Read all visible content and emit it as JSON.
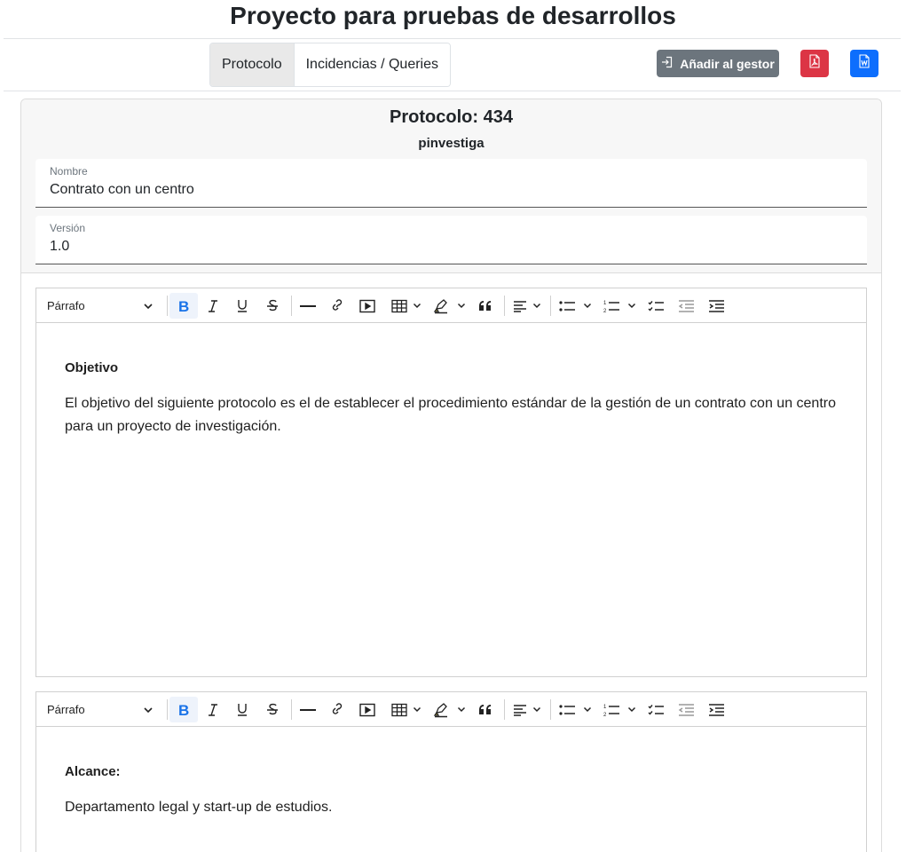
{
  "page": {
    "title": "Proyecto para pruebas de desarrollos"
  },
  "tabs": [
    {
      "label": "Protocolo",
      "active": true
    },
    {
      "label": "Incidencias / Queries",
      "active": false
    }
  ],
  "actions": {
    "add_manager_label": "Añadir al gestor",
    "pdf_icon": "file-pdf-icon",
    "word_icon": "file-word-icon"
  },
  "protocol": {
    "title": "Protocolo: 434",
    "user": "pinvestiga"
  },
  "fields": {
    "name": {
      "label": "Nombre",
      "value": "Contrato con un centro"
    },
    "version": {
      "label": "Versión",
      "value": "1.0"
    }
  },
  "toolbar": {
    "paragraph_label": "Párrafo"
  },
  "editors": [
    {
      "heading": "Objetivo",
      "body": "El objetivo del siguiente protocolo es el de establecer el procedimiento estándar de la gestión de un contrato con un centro para un proyecto de investigación."
    },
    {
      "heading": "Alcance:",
      "body": "Departamento legal y start-up de estudios."
    }
  ],
  "colors": {
    "pdf": "#dc3545",
    "word": "#0d6efd",
    "secondary": "#6c757d",
    "bold_active": "#1a73e8"
  }
}
